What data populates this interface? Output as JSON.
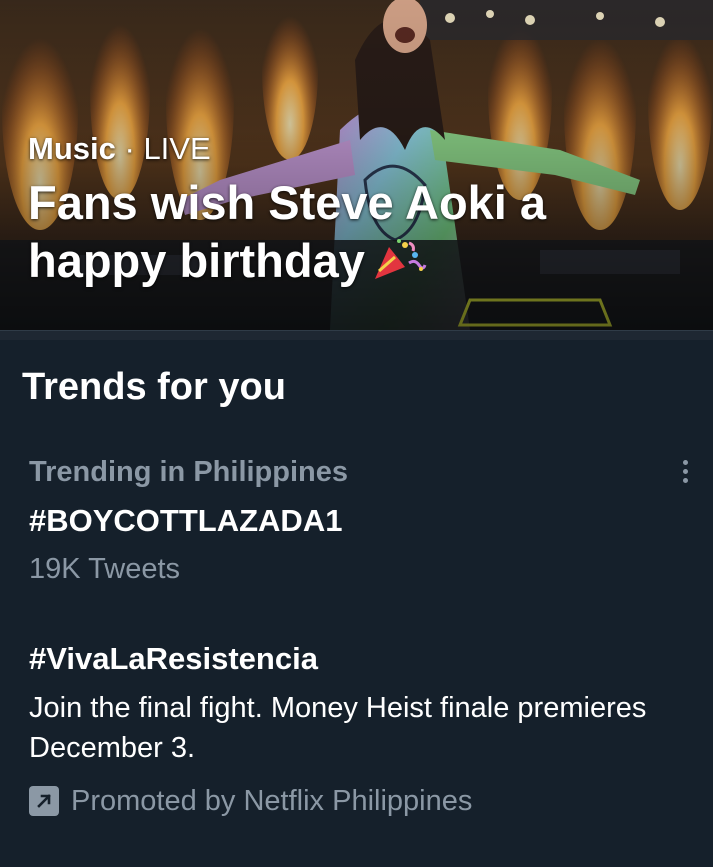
{
  "hero": {
    "category": "Music",
    "separator": "·",
    "status": "LIVE",
    "title": "Fans wish Steve Aoki a happy birthday",
    "emoji_icon": "party-popper-icon",
    "image_subject": "dj-performer-with-stage-pyrotechnics"
  },
  "trends": {
    "heading": "Trends for you",
    "items": [
      {
        "context": "Trending in Philippines",
        "name": "#BOYCOTTLAZADA1",
        "count": "19K Tweets",
        "menu_icon": "more-vertical-icon"
      },
      {
        "name": "#VivaLaResistencia",
        "description": "Join the final fight. Money Heist finale premieres December 3.",
        "promoted_icon": "promoted-arrow-icon",
        "promoted_text": "Promoted by Netflix Philippines"
      }
    ]
  },
  "colors": {
    "background": "#15202b",
    "secondary_text": "#8b98a5",
    "primary_text": "#ffffff"
  }
}
